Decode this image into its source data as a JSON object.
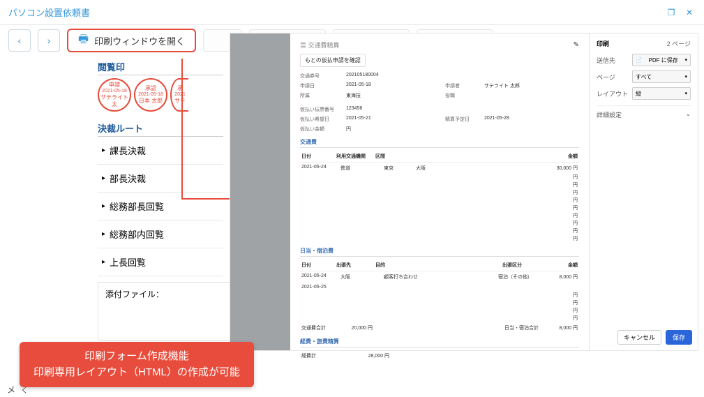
{
  "header": {
    "title": "パソコン設置依頼書"
  },
  "toolbar": {
    "print_label": "印刷ウィンドウを開く"
  },
  "sections": {
    "kanran": "閲覧印",
    "route": "決裁ルート",
    "attach": "添付ファイル："
  },
  "stamps": [
    {
      "top": "申請",
      "mid": "2021-05-18",
      "bot": "サテライト 太"
    },
    {
      "top": "承認",
      "mid": "2021-05-18",
      "bot": "日本 太郎"
    },
    {
      "top": "承",
      "mid": "2021",
      "bot": "サテ"
    }
  ],
  "routes": [
    "課長決裁",
    "部長決裁",
    "総務部長回覧",
    "総務部内回覧",
    "上長回覧"
  ],
  "callout": {
    "l1": "印刷フォーム作成機能",
    "l2": "印刷専用レイアウト（HTML）の作成が可能"
  },
  "footer": {
    "l1": "メ",
    "l2": "く"
  },
  "print_panel": {
    "title": "印刷",
    "pages": "2 ページ",
    "dest_lbl": "送信先",
    "dest_val": "PDF に保存",
    "page_lbl": "ページ",
    "page_val": "すべて",
    "layout_lbl": "レイアウト",
    "layout_val": "縦",
    "more": "詳細設定",
    "cancel": "キャンセル",
    "save": "保存"
  },
  "doc": {
    "title": "交通費精算",
    "btn": "もとの仮払申請を確認",
    "rows1": [
      [
        "交通券号",
        "202105180004",
        "",
        ""
      ],
      [
        "申請日",
        "2021-05-18",
        "申請者",
        "サテライト 太郎"
      ],
      [
        "所属",
        "東海技",
        "役職",
        ""
      ]
    ],
    "rows2": [
      [
        "仮払い伝票番号",
        "123456",
        "",
        ""
      ],
      [
        "仮払い希望日",
        "2021-05-21",
        "精算予定日",
        "2021-05-28"
      ],
      [
        "仮払い金額",
        "円",
        "",
        ""
      ]
    ],
    "sec_kotsu": "交通費",
    "k_head": [
      "日付",
      "利用交通機関",
      "区間",
      "",
      "金額"
    ],
    "k_row": [
      "2021-05-24",
      "鉄道",
      "東京",
      "大阪",
      "30,000 円"
    ],
    "sec_nit": "日当・宿泊費",
    "n_head": [
      "日付",
      "出張先",
      "目的",
      "出張区分",
      "金額"
    ],
    "n_row1": [
      "2021-05-24",
      "大阪",
      "顧客打ち合わせ",
      "宿泊（その他）",
      "8,000 円"
    ],
    "n_row2": [
      "2021-05-25",
      "",
      "",
      "",
      ""
    ],
    "tot1_l": "交通費合計",
    "tot1_v": "20,000  円",
    "tot2_l": "日当・宿泊合計",
    "tot2_v": "8,000  円",
    "sec_kei": "経費・旅費精算",
    "kei_l": "経費計",
    "kei_v": "28,000  円"
  }
}
